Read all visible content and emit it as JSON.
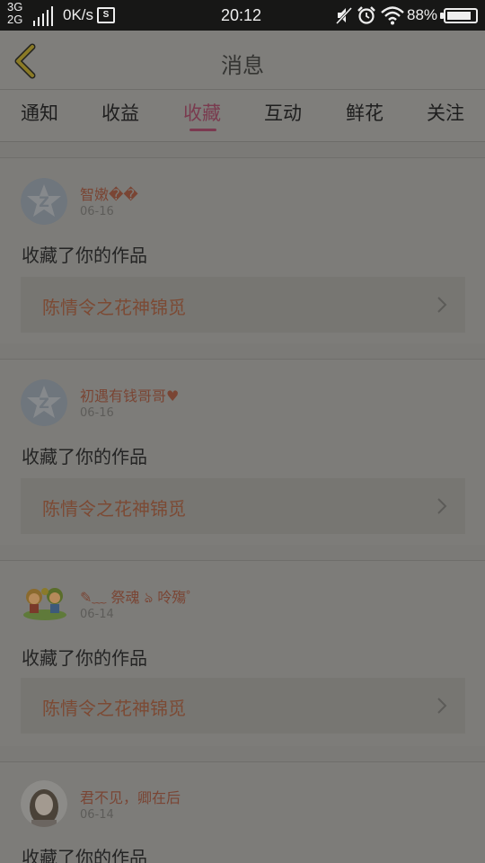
{
  "status_bar": {
    "network_top": "3G",
    "network_bottom": "2G",
    "speed": "0K/s",
    "screenshot_badge": "S",
    "time": "20:12",
    "battery_percent_text": "88%",
    "battery_level": 0.88,
    "icons": [
      "signal-icon",
      "mute-icon",
      "alarm-icon",
      "wifi-icon",
      "battery-icon"
    ]
  },
  "header": {
    "title": "消息"
  },
  "tabs": [
    {
      "label": "通知"
    },
    {
      "label": "收益"
    },
    {
      "label": "收藏"
    },
    {
      "label": "互动"
    },
    {
      "label": "鲜花"
    },
    {
      "label": "关注"
    }
  ],
  "active_tab": "收藏",
  "feed": [
    {
      "username": "智嫩��",
      "date": "06-16",
      "action": "收藏了你的作品",
      "work_title": "陈情令之花神锦觅",
      "avatar": "default-avatar"
    },
    {
      "username": "初遇有钱哥哥♥",
      "date": "06-16",
      "action": "收藏了你的作品",
      "work_title": "陈情令之花神锦觅",
      "avatar": "default-avatar"
    },
    {
      "username": "✎﹏ 祭魂 ঌ 呤殤゜",
      "date": "06-14",
      "action": "收藏了你的作品",
      "work_title": "陈情令之花神锦觅",
      "avatar": "cartoon-avatar"
    },
    {
      "username": "君不见，卿在后",
      "date": "06-14",
      "action": "收藏了你的作品",
      "work_title": "",
      "avatar": "photo-avatar"
    }
  ]
}
